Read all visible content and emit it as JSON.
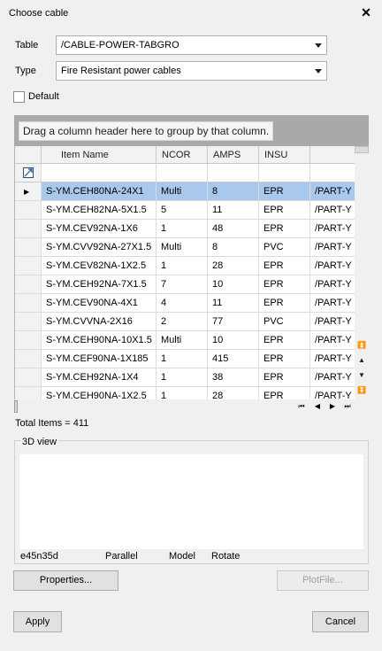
{
  "window": {
    "title": "Choose cable",
    "close_glyph": "✕"
  },
  "form": {
    "table_label": "Table",
    "table_value": "/CABLE-POWER-TABGRO",
    "type_label": "Type",
    "type_value": "Fire Resistant power cables",
    "default_label": "Default",
    "default_checked": false
  },
  "grid": {
    "group_hint": "Drag a column header here to group by that column.",
    "columns": [
      "Item Name",
      "NCOR",
      "AMPS",
      "INSU",
      ""
    ],
    "rows": [
      [
        "S-YM.CEH80NA-24X1",
        "Multi",
        "8",
        "EPR",
        "/PART-Y"
      ],
      [
        "S-YM.CEH82NA-5X1.5",
        "5",
        "11",
        "EPR",
        "/PART-Y"
      ],
      [
        "S-YM.CEV92NA-1X6",
        "1",
        "48",
        "EPR",
        "/PART-Y"
      ],
      [
        "S-YM.CVV92NA-27X1.5",
        "Multi",
        "8",
        "PVC",
        "/PART-Y"
      ],
      [
        "S-YM.CEV82NA-1X2.5",
        "1",
        "28",
        "EPR",
        "/PART-Y"
      ],
      [
        "S-YM.CEH92NA-7X1.5",
        "7",
        "10",
        "EPR",
        "/PART-Y"
      ],
      [
        "S-YM.CEV90NA-4X1",
        "4",
        "11",
        "EPR",
        "/PART-Y"
      ],
      [
        "S-YM.CVVNA-2X16",
        "2",
        "77",
        "PVC",
        "/PART-Y"
      ],
      [
        "S-YM.CEH90NA-10X1.5",
        "Multi",
        "10",
        "EPR",
        "/PART-Y"
      ],
      [
        "S-YM.CEF90NA-1X185",
        "1",
        "415",
        "EPR",
        "/PART-Y"
      ],
      [
        "S-YM.CEH92NA-1X4",
        "1",
        "38",
        "EPR",
        "/PART-Y"
      ],
      [
        "S-YM.CEH90NA-1X2.5",
        "1",
        "28",
        "EPR",
        "/PART-Y"
      ]
    ],
    "selected_row": 0,
    "total_items": "Total Items = 411"
  },
  "view3d": {
    "label": "3D view",
    "status": {
      "coord": "e45n35d",
      "projection": "Parallel",
      "mode": "Model",
      "action": "Rotate"
    }
  },
  "buttons": {
    "properties": "Properties...",
    "plotfile": "PlotFile...",
    "apply": "Apply",
    "cancel": "Cancel"
  },
  "icons": {
    "filter": "filter-icon",
    "row_indicator": "current-row-arrow-icon",
    "scroll_first": "scroll-top-icon",
    "scroll_up": "scroll-up-icon",
    "scroll_down": "scroll-down-icon",
    "scroll_last": "scroll-bottom-icon"
  },
  "colors": {
    "selection": "#a8c8ec",
    "group_bar": "#a9a9a9"
  }
}
